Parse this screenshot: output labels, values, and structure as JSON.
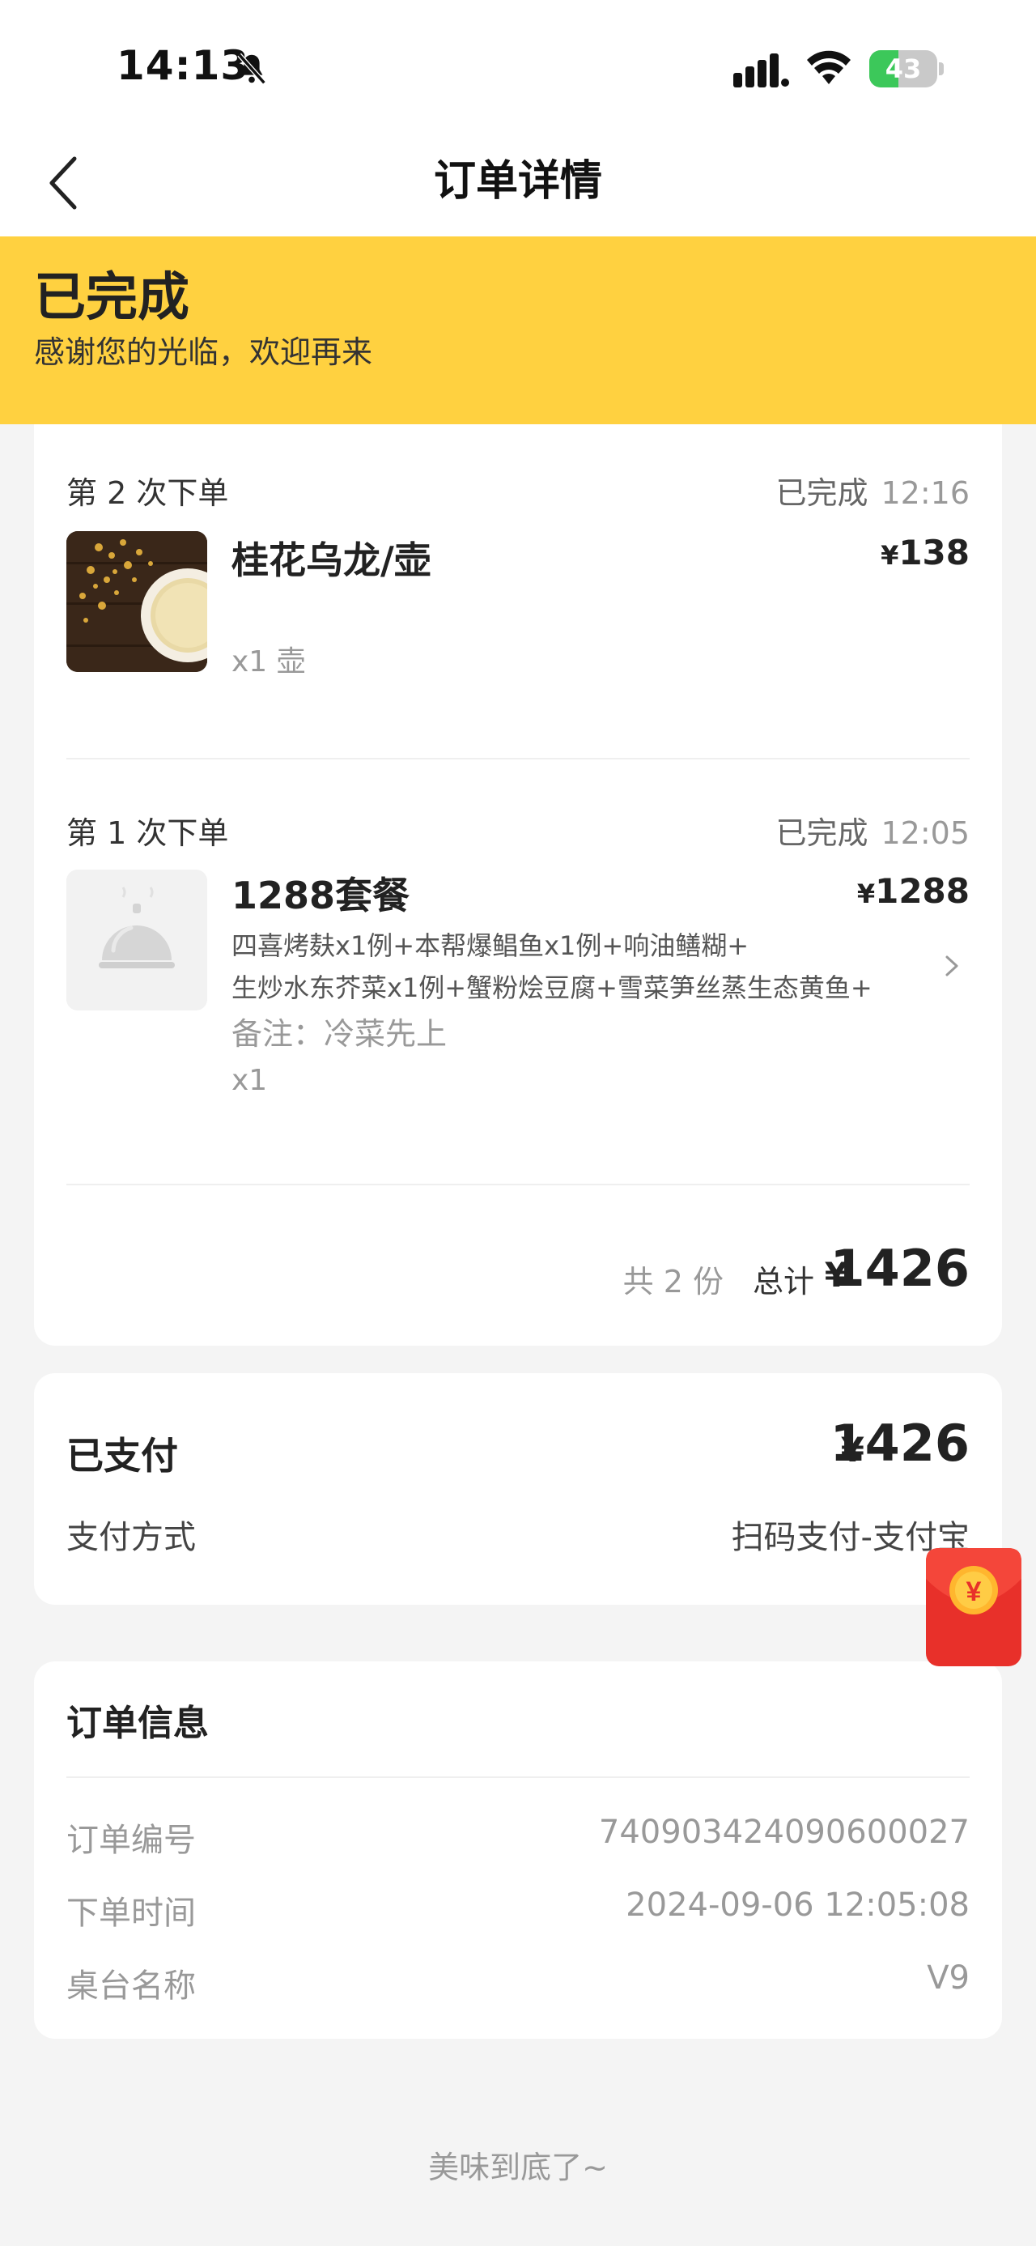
{
  "status_bar": {
    "time": "14:13",
    "battery": "43",
    "battery_level": 0.43
  },
  "nav": {
    "title": "订单详情"
  },
  "banner": {
    "title": "已完成",
    "subtitle": "感谢您的光临，欢迎再来"
  },
  "orders": [
    {
      "round": "第 2 次下单",
      "status": "已完成",
      "time": "12:16",
      "item": {
        "name": "桂花乌龙/壶",
        "currency": "¥",
        "price": "138",
        "qty": "x1 壶"
      }
    },
    {
      "round": "第 1 次下单",
      "status": "已完成",
      "time": "12:05",
      "item": {
        "name": "1288套餐",
        "currency": "¥",
        "price": "1288",
        "desc_line1": "四喜烤麸x1例+本帮爆鲳鱼x1例+响油鳝糊+",
        "desc_line2": "生炒水东芥菜x1例+蟹粉烩豆腐+雪菜笋丝蒸生态黄鱼+",
        "note": "备注：冷菜先上",
        "qty": "x1"
      }
    }
  ],
  "summary": {
    "count": "共 2 份",
    "label": "总计",
    "currency": "¥",
    "total": "1426"
  },
  "payment": {
    "title": "已支付",
    "currency": "¥",
    "amount": "1426",
    "method_label": "支付方式",
    "method_value": "扫码支付-支付宝"
  },
  "info": {
    "title": "订单信息",
    "rows": [
      {
        "label": "订单编号",
        "value": "740903424090600027"
      },
      {
        "label": "下单时间",
        "value": "2024-09-06 12:05:08"
      },
      {
        "label": "桌台名称",
        "value": "V9"
      }
    ]
  },
  "footer": {
    "text": "美味到底了~"
  },
  "colors": {
    "banner": "#ffd140",
    "background": "#f4f4f4",
    "battery": "#3cc85a",
    "redpack": "#e8302a"
  }
}
